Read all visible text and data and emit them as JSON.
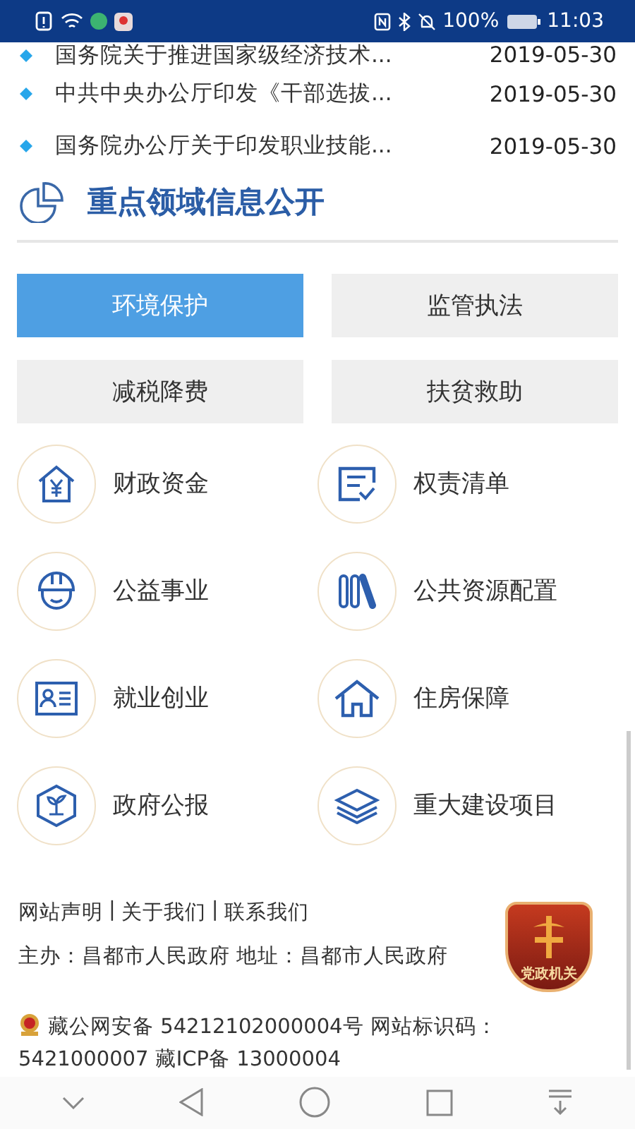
{
  "status_bar": {
    "battery": "100%",
    "time": "11:03"
  },
  "news": [
    {
      "title": "国务院关于推进国家级经济技术...",
      "date": "2019-05-30"
    },
    {
      "title": "中共中央办公厅印发《干部选拔...",
      "date": "2019-05-30"
    },
    {
      "title": "国务院办公厅关于印发职业技能...",
      "date": "2019-05-30"
    }
  ],
  "section": {
    "title": "重点领域信息公开"
  },
  "tabs": [
    {
      "label": "环境保护",
      "selected": true
    },
    {
      "label": "监管执法",
      "selected": false
    },
    {
      "label": "减税降费",
      "selected": false
    },
    {
      "label": "扶贫救助",
      "selected": false
    }
  ],
  "categories": [
    {
      "label": "财政资金",
      "kind": "money"
    },
    {
      "label": "权责清单",
      "kind": "list"
    },
    {
      "label": "公益事业",
      "kind": "helmet"
    },
    {
      "label": "公共资源配置",
      "kind": "books"
    },
    {
      "label": "就业创业",
      "kind": "card"
    },
    {
      "label": "住房保障",
      "kind": "house"
    },
    {
      "label": "政府公报",
      "kind": "plant"
    },
    {
      "label": "重大建设项目",
      "kind": "layers"
    }
  ],
  "footer": {
    "links": [
      "网站声明",
      "关于我们",
      "联系我们"
    ],
    "separators": [
      "|",
      "|"
    ],
    "host": "主办：昌都市人民政府  地址：昌都市人民政府",
    "record": "藏公网安备 54212102000004号  网站标识码：5421000007  藏ICP备 13000004",
    "badge": "党政机关"
  }
}
